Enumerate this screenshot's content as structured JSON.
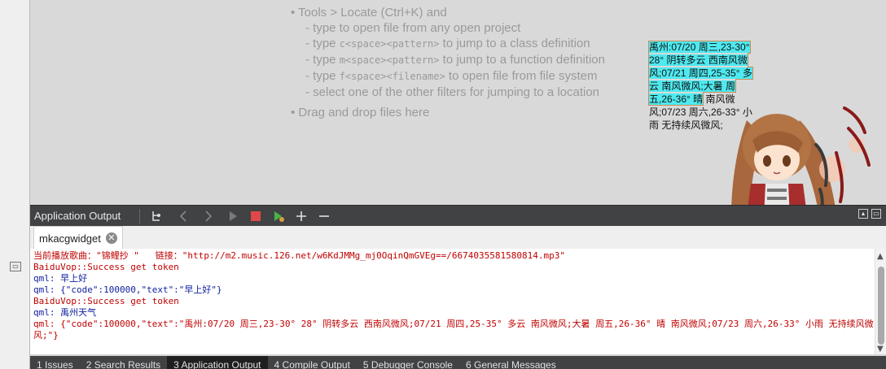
{
  "editor_hints": {
    "locate_line": "• Tools > Locate (Ctrl+K) and",
    "open_file": "- type to open file from any open project",
    "class_prefix": "- type ",
    "class_code": "c<space><pattern>",
    "class_suffix": " to jump to a class definition",
    "function_prefix": "- type ",
    "function_code": "m<space><pattern>",
    "function_suffix": " to jump to a function definition",
    "file_prefix": "- type ",
    "file_code": "f<space><filename>",
    "file_suffix": " to open file from file system",
    "filters": "- select one of the other filters for jumping to a location",
    "drag_drop": "• Drag and drop files here"
  },
  "weather_note": {
    "highlighted": "禹州:07/20 周三,23-30° 28° 阴转多云 西南风微风;07/21 周四,25-35° 多云 南风微风;大暑 周五,26-36° 晴",
    "rest": " 南风微风;07/23 周六,26-33° 小雨 无持续风微风;"
  },
  "panel": {
    "title": "Application Output",
    "buttons": [
      "attach-icon",
      "prev-icon",
      "next-icon",
      "run-icon",
      "stop-icon",
      "debug-run-icon",
      "zoom-in-icon",
      "zoom-out-icon"
    ]
  },
  "output_tab": {
    "label": "mkacgwidget",
    "close": "✕"
  },
  "output_lines": [
    {
      "text": "当前播放歌曲：\"锦鲤抄 \"   链接：\"http://m2.music.126.net/w6KdJMMg_mj0OqinQmGVEg==/6674035581580814.mp3\"",
      "color": "red"
    },
    {
      "text": "BaiduVop::Success get token",
      "color": "red"
    },
    {
      "text": "qml: 早上好",
      "color": "blue"
    },
    {
      "text": "qml: {\"code\":100000,\"text\":\"早上好\"}",
      "color": "blue"
    },
    {
      "text": "BaiduVop::Success get token",
      "color": "red"
    },
    {
      "text": "qml: 禹州天气",
      "color": "blue"
    },
    {
      "text": "qml: {\"code\":100000,\"text\":\"禹州:07/20 周三,23-30° 28° 阴转多云 西南风微风;07/21 周四,25-35° 多云 南风微风;大暑 周五,26-36° 晴 南风微风;07/23 周六,26-33° 小雨 无持续风微风;\"}",
      "color": "red"
    }
  ],
  "bottom_tabs": [
    {
      "label": "1 Issues",
      "active": false
    },
    {
      "label": "2 Search Results",
      "active": false
    },
    {
      "label": "3 Application Output",
      "active": true
    },
    {
      "label": "4 Compile Output",
      "active": false
    },
    {
      "label": "5 Debugger Console",
      "active": false
    },
    {
      "label": "6 General Messages",
      "active": false
    }
  ],
  "colors": {
    "panel_dark": "#404244",
    "output_red": "#c00000",
    "output_blue": "#1020a0",
    "highlight": "#4eeaf0",
    "stop_red": "#e04848",
    "run_green": "#46b446"
  }
}
